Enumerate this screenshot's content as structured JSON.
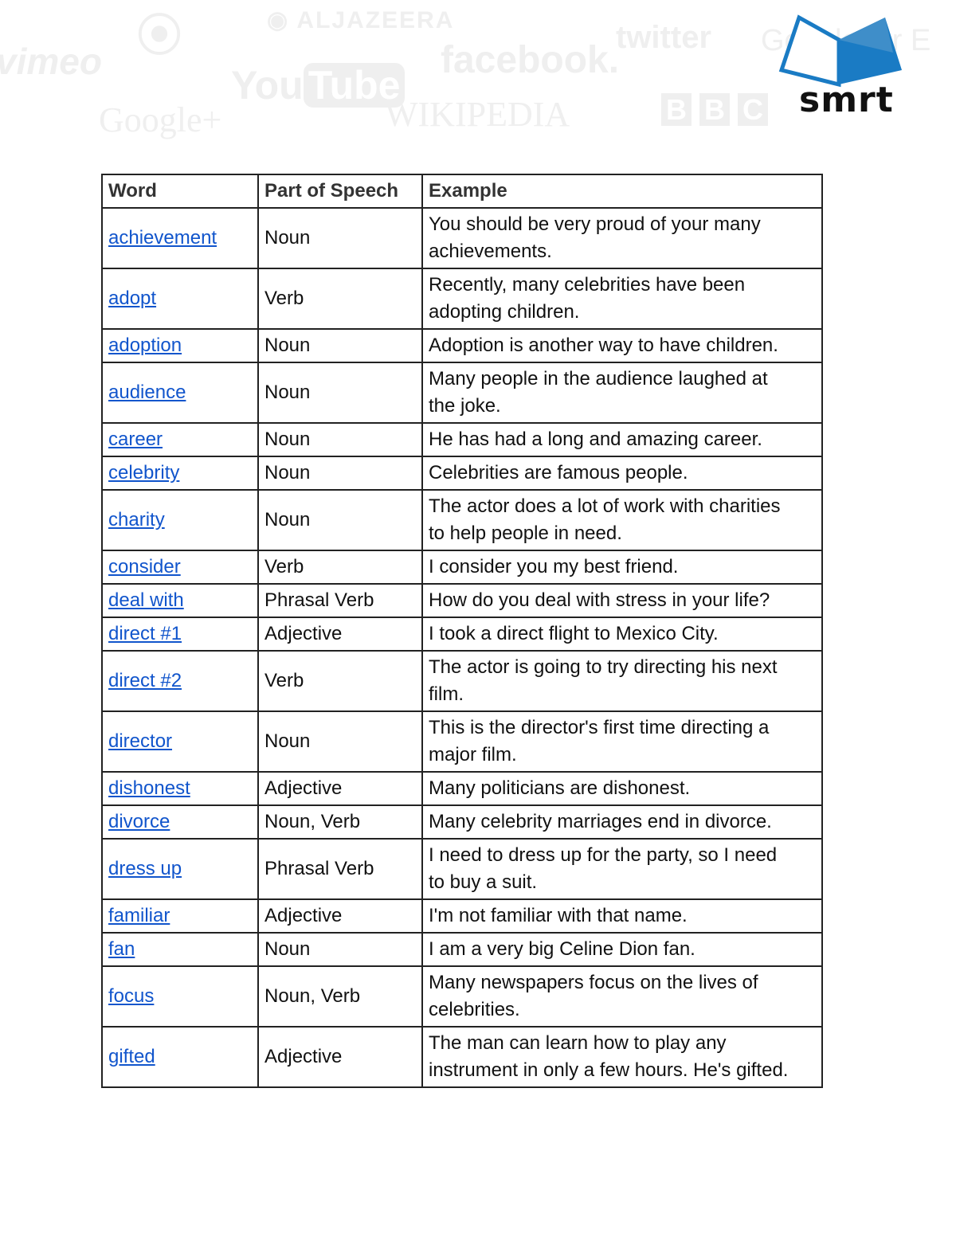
{
  "header": {
    "background_logos": [
      "vimeo",
      "ALJAZEERA",
      "YouTube",
      "facebook",
      "twitter",
      "Google+",
      "WIKIPEDIA",
      "BBC",
      "Google for Education"
    ],
    "brand_logo": "smrt",
    "brand_color": "#1a7bc4"
  },
  "table": {
    "columns": [
      "Word",
      "Part of Speech",
      "Example"
    ],
    "link_color": "#1155cc",
    "rows": [
      {
        "word": "achievement",
        "pos": "Noun",
        "example": "You should be very proud of your many\nachievements."
      },
      {
        "word": "adopt",
        "pos": "Verb",
        "example": "Recently, many celebrities have been\nadopting children."
      },
      {
        "word": "adoption",
        "pos": "Noun",
        "example": "Adoption is another way to have children."
      },
      {
        "word": "audience",
        "pos": "Noun",
        "example": "Many people in the audience laughed at\nthe joke."
      },
      {
        "word": "career",
        "pos": "Noun",
        "example": "He has had a long and amazing career."
      },
      {
        "word": "celebrity",
        "pos": "Noun",
        "example": "Celebrities are famous people."
      },
      {
        "word": "charity",
        "pos": "Noun",
        "example": "The actor does a lot of work with charities\nto help people in need."
      },
      {
        "word": "consider",
        "pos": "Verb",
        "example": "I consider you my best friend."
      },
      {
        "word": "deal with",
        "pos": "Phrasal Verb",
        "example": "How do you deal with stress in your life?"
      },
      {
        "word": "direct #1",
        "pos": "Adjective",
        "example": "I took a direct flight to Mexico City."
      },
      {
        "word": "direct #2",
        "pos": "Verb",
        "example": "The actor is going to try directing his next\nfilm."
      },
      {
        "word": "director",
        "pos": "Noun",
        "example": "This is the director's first time directing a\nmajor film."
      },
      {
        "word": "dishonest",
        "pos": "Adjective",
        "example": "Many politicians are dishonest."
      },
      {
        "word": "divorce",
        "pos": "Noun, Verb",
        "example": "Many celebrity marriages end in divorce."
      },
      {
        "word": "dress up",
        "pos": "Phrasal Verb",
        "example": "I need to dress up for the party, so I need\nto buy a suit."
      },
      {
        "word": "familiar",
        "pos": "Adjective",
        "example": "I'm not familiar with that name."
      },
      {
        "word": "fan",
        "pos": "Noun",
        "example": "I am a very big Celine Dion fan."
      },
      {
        "word": "focus",
        "pos": "Noun, Verb",
        "example": "Many newspapers focus on the lives of\ncelebrities."
      },
      {
        "word": "gifted",
        "pos": "Adjective",
        "example": "The man can learn how to play any\ninstrument in only a few hours. He's gifted."
      }
    ]
  }
}
